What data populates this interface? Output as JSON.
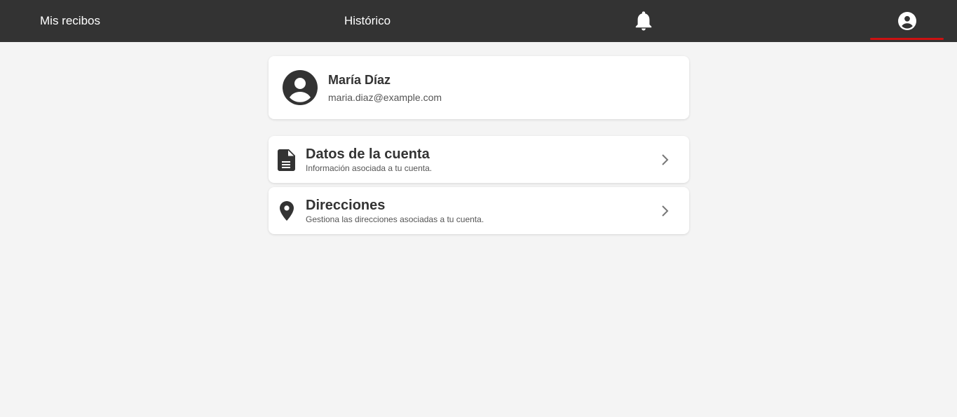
{
  "nav": {
    "recibos_label": "Mis recibos",
    "historico_label": "Histórico",
    "bell_icon": "bell-icon",
    "profile_icon": "account-circle-icon",
    "active_indicator_color": "#cc1111"
  },
  "profile": {
    "name": "María Díaz",
    "email": "maria.diaz@example.com",
    "avatar_icon": "account-circle-icon"
  },
  "menu": [
    {
      "icon": "document-icon",
      "title": "Datos de la cuenta",
      "subtitle": "Información asociada a tu cuenta."
    },
    {
      "icon": "location-pin-icon",
      "title": "Direcciones",
      "subtitle": "Gestiona las direcciones asociadas a tu cuenta."
    }
  ],
  "colors": {
    "topbar": "#333333",
    "background": "#f4f4f4",
    "card": "#ffffff",
    "accent": "#cc1111"
  }
}
